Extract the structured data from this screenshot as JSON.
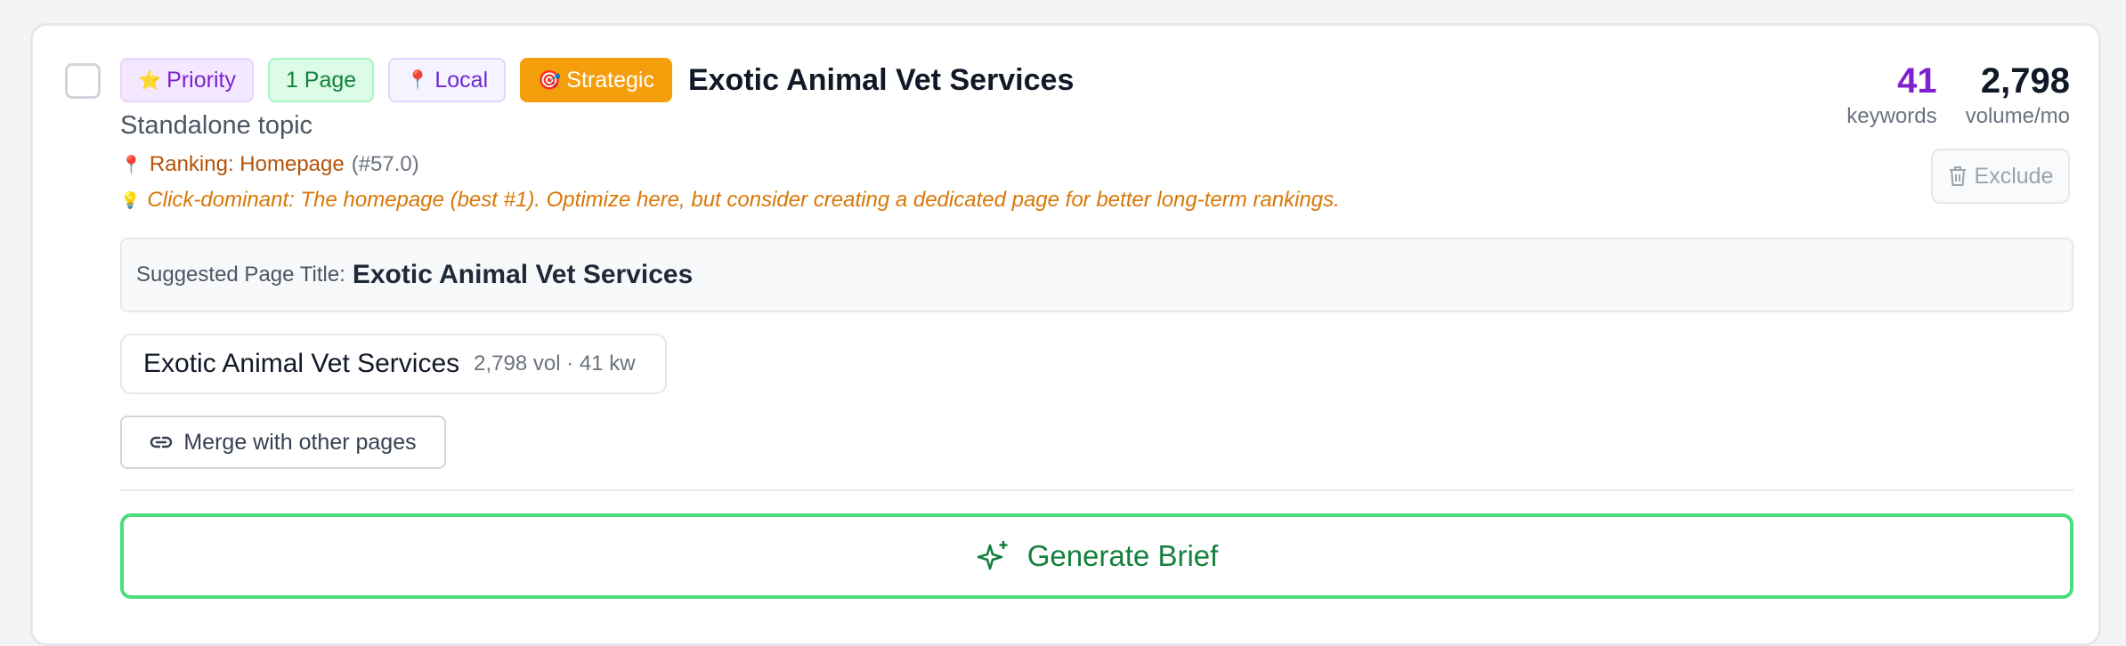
{
  "tags": {
    "priority": "Priority",
    "page": "1 Page",
    "local": "Local",
    "strategic": "Strategic"
  },
  "icons": {
    "priority": "⭐",
    "local": "📍",
    "strategic": "🎯",
    "ranking": "📍",
    "tip": "💡"
  },
  "topic": {
    "title": "Exotic Animal Vet Services",
    "subtitle": "Standalone topic"
  },
  "ranking": {
    "label": "Ranking: Homepage",
    "position": "(#57.0)"
  },
  "tip": "Click-dominant: The homepage (best #1). Optimize here, but consider creating a dedicated page for better long-term rankings.",
  "stats": {
    "keywords_value": "41",
    "keywords_label": "keywords",
    "volume_value": "2,798",
    "volume_label": "volume/mo"
  },
  "exclude_label": "Exclude",
  "suggested": {
    "label": "Suggested Page Title:",
    "value": "Exotic Animal Vet Services"
  },
  "page_chip": {
    "name": "Exotic Animal Vet Services",
    "meta": "2,798 vol · 41 kw"
  },
  "merge_label": "Merge with other pages",
  "generate_label": "Generate Brief",
  "colors": {
    "keywords_accent": "#7e22ce",
    "strategic": "#f59e0b",
    "generate_border": "#4ade80",
    "generate_text": "#15803d"
  }
}
